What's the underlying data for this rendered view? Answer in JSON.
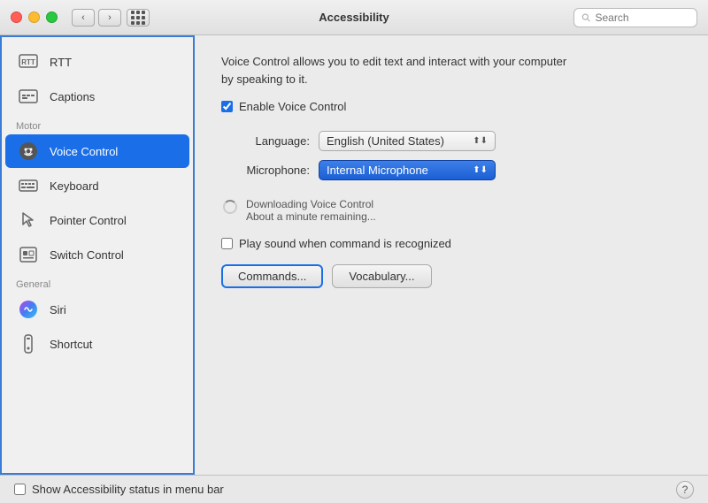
{
  "titlebar": {
    "title": "Accessibility",
    "search_placeholder": "Search"
  },
  "sidebar": {
    "items": [
      {
        "id": "rtt",
        "label": "RTT",
        "icon": "rtt-icon",
        "section": null
      },
      {
        "id": "captions",
        "label": "Captions",
        "icon": "captions-icon",
        "section": null
      },
      {
        "id": "voice-control",
        "label": "Voice Control",
        "icon": "voice-control-icon",
        "section": "Motor",
        "active": true
      },
      {
        "id": "keyboard",
        "label": "Keyboard",
        "icon": "keyboard-icon",
        "section": null
      },
      {
        "id": "pointer-control",
        "label": "Pointer Control",
        "icon": "pointer-icon",
        "section": null
      },
      {
        "id": "switch-control",
        "label": "Switch Control",
        "icon": "switch-icon",
        "section": null
      },
      {
        "id": "siri",
        "label": "Siri",
        "icon": "siri-icon",
        "section": "General"
      },
      {
        "id": "shortcut",
        "label": "Shortcut",
        "icon": "shortcut-icon",
        "section": null
      }
    ]
  },
  "content": {
    "description": "Voice Control allows you to edit text and interact with your computer by speaking to it.",
    "enable_label": "Enable Voice Control",
    "language_label": "Language:",
    "language_value": "English (United States)",
    "microphone_label": "Microphone:",
    "microphone_value": "Internal Microphone",
    "downloading_title": "Downloading Voice Control",
    "downloading_subtitle": "About a minute remaining...",
    "play_sound_label": "Play sound when command is recognized",
    "commands_btn": "Commands...",
    "vocabulary_btn": "Vocabulary..."
  },
  "bottombar": {
    "show_label": "Show Accessibility status in menu bar",
    "help_label": "?"
  }
}
